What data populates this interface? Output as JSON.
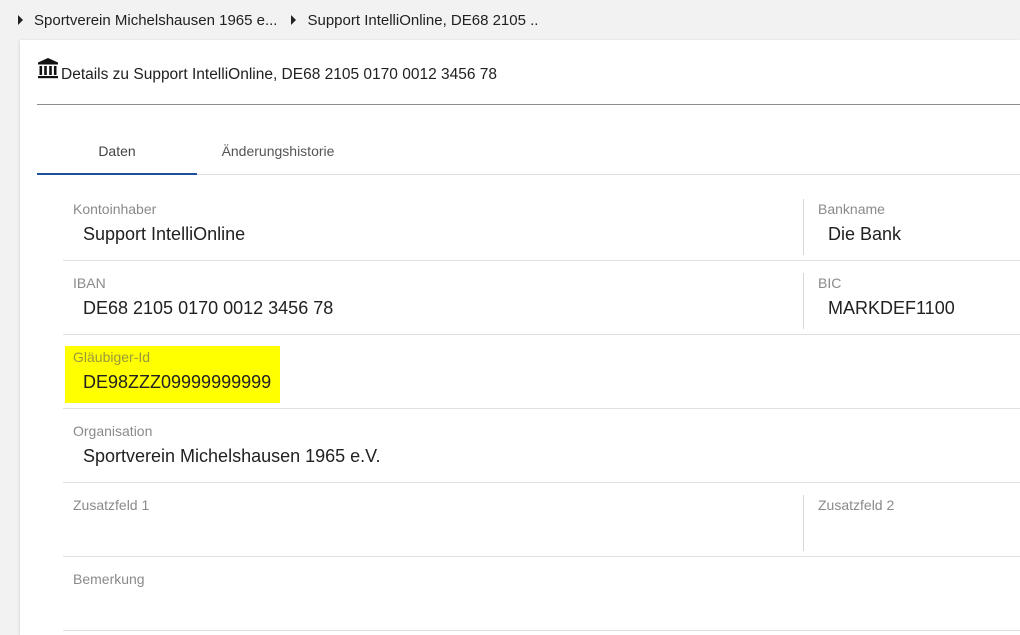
{
  "breadcrumb": {
    "items": [
      "Sportverein Michelshausen 1965 e...",
      "Support IntelliOnline, DE68 2105 .."
    ]
  },
  "card": {
    "icon": "bank-icon",
    "title": "Details zu Support IntelliOnline, DE68 2105 0170 0012 3456 78"
  },
  "tabs": {
    "items": [
      "Daten",
      "Änderungshistorie"
    ],
    "active": "Daten"
  },
  "form": {
    "kontoinhaber": {
      "label": "Kontoinhaber",
      "value": "Support IntelliOnline"
    },
    "bankname": {
      "label": "Bankname",
      "value": "Die Bank"
    },
    "iban": {
      "label": "IBAN",
      "value": "DE68 2105 0170 0012 3456 78"
    },
    "bic": {
      "label": "BIC",
      "value": "MARKDEF1100"
    },
    "glaeubiger_id": {
      "label": "Gläubiger-Id",
      "value": "DE98ZZZ09999999999",
      "highlight_color": "#ffff00"
    },
    "organisation": {
      "label": "Organisation",
      "value": "Sportverein Michelshausen 1965 e.V."
    },
    "zusatzfeld1": {
      "label": "Zusatzfeld 1",
      "value": ""
    },
    "zusatzfeld2": {
      "label": "Zusatzfeld 2",
      "value": ""
    },
    "bemerkung": {
      "label": "Bemerkung",
      "value": ""
    }
  },
  "colors": {
    "accent": "#1e4f9c",
    "highlight": "#ffff00"
  }
}
